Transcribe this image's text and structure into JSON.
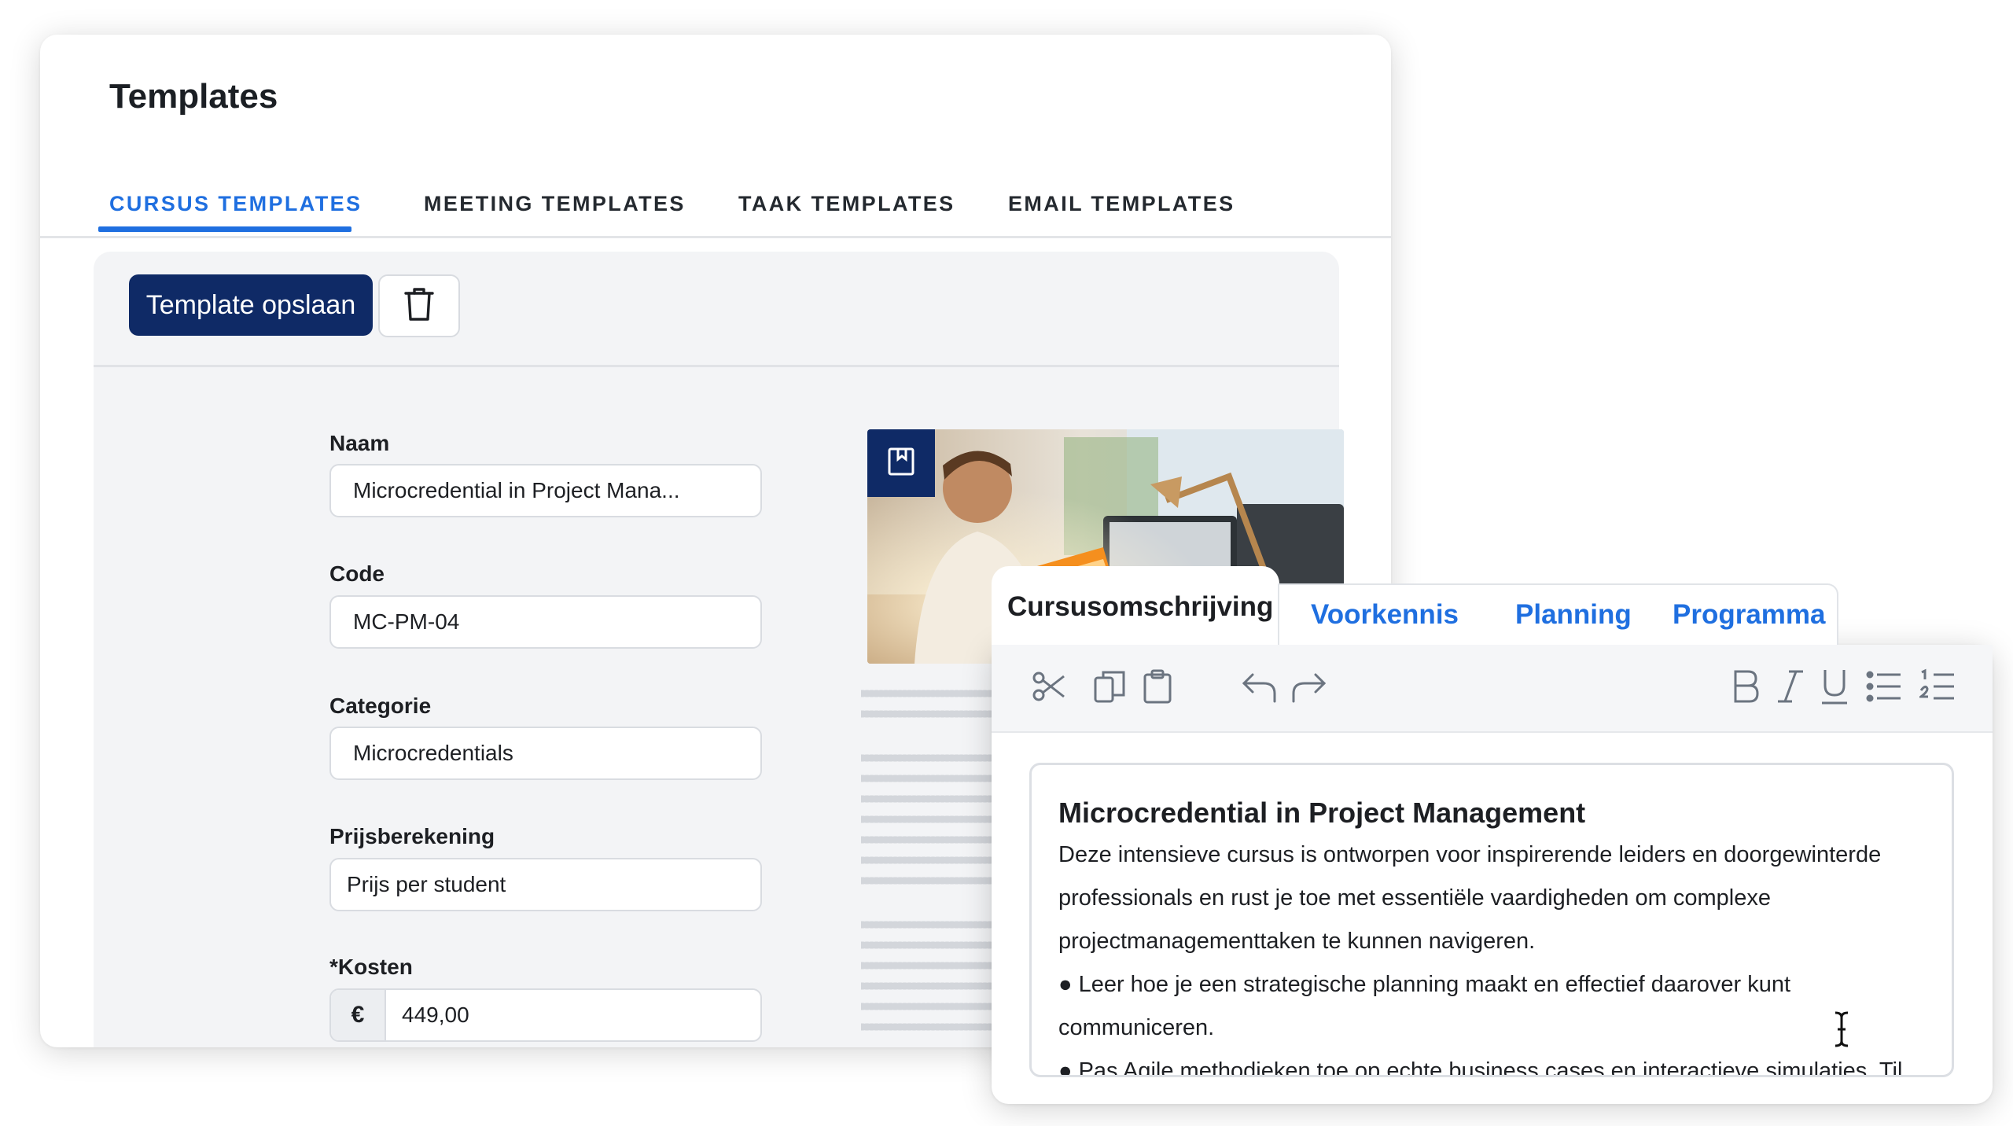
{
  "page": {
    "title": "Templates",
    "tabs": [
      {
        "label": "CURSUS TEMPLATES",
        "active": true
      },
      {
        "label": "MEETING TEMPLATES",
        "active": false
      },
      {
        "label": "TAAK TEMPLATES",
        "active": false
      },
      {
        "label": "EMAIL TEMPLATES",
        "active": false
      }
    ]
  },
  "toolbar": {
    "save_label": "Template opslaan",
    "delete_icon": "trash-icon"
  },
  "form": {
    "naam": {
      "label": "Naam",
      "value": "Microcredential in Project Mana..."
    },
    "code": {
      "label": "Code",
      "value": "MC-PM-04"
    },
    "categorie": {
      "label": "Categorie",
      "value": "Microcredentials"
    },
    "prijs": {
      "label": "Prijsberekening",
      "value": "Prijs per student"
    },
    "kosten": {
      "label": "*Kosten",
      "currency": "€",
      "value": "449,00"
    }
  },
  "image": {
    "badge_icon": "bookmark-icon"
  },
  "editor": {
    "tabs": [
      {
        "label": "Cursusomschrijving",
        "active": true
      },
      {
        "label": "Voorkennis",
        "active": false
      },
      {
        "label": "Planning",
        "active": false
      },
      {
        "label": "Programma",
        "active": false
      }
    ],
    "toolbar_icons": [
      "scissors-icon",
      "copy-icon",
      "paste-icon",
      "undo-icon",
      "redo-icon",
      "bold-icon",
      "italic-icon",
      "underline-icon",
      "bullet-list-icon",
      "numbered-list-icon"
    ],
    "doc_title": "Microcredential in Project Management",
    "lines": [
      "Deze intensieve cursus is ontworpen voor inspirerende leiders en doorgewinterde",
      "professionals en rust je toe met essentiële vaardigheden om complexe",
      "projectmanagementtaken te kunnen navigeren.",
      "● Leer hoe je een strategische planning maakt en effectief daarover kunt",
      "communiceren.",
      "● Pas Agile methodieken toe op echte business cases en interactieve simulaties. Til"
    ]
  },
  "colors": {
    "accent": "#1f6fe0",
    "navy": "#0f2a66",
    "panel_bg": "#f3f4f6"
  }
}
